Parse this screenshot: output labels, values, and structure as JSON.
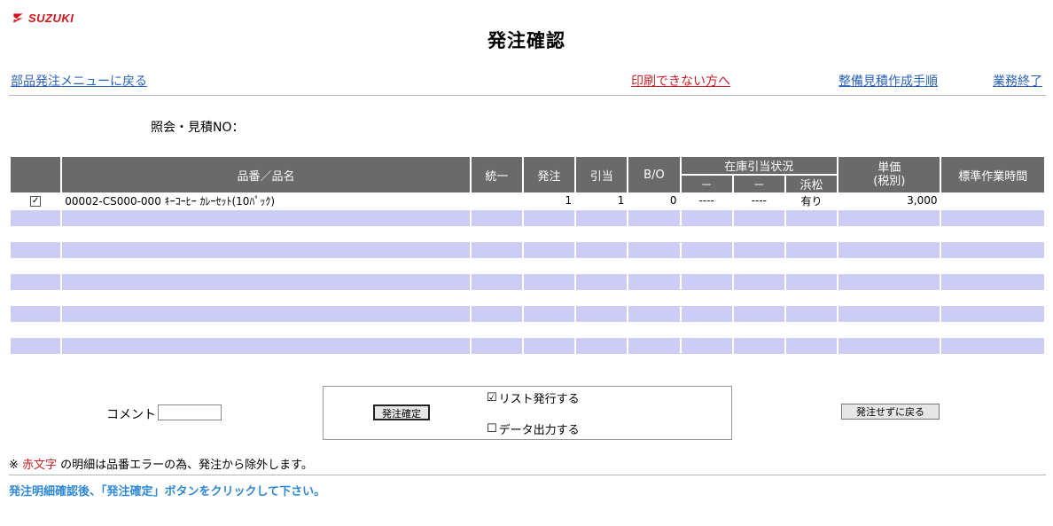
{
  "brand": {
    "logo_text": "SUZUKI",
    "color": "#d0121b"
  },
  "title": "発注確認",
  "nav": {
    "back_menu": "部品発注メニューに戻る",
    "cannot_print": "印刷できない方へ",
    "estimate_procedure": "整備見積作成手順",
    "end_work": "業務終了"
  },
  "ref_label": "照会・見積NO：",
  "table": {
    "headers": {
      "part": "品番／品名",
      "unify": "統一",
      "order": "発注",
      "alloc": "引当",
      "bo": "B/O",
      "stock_status": "在庫引当状況",
      "stock_sub1": "－",
      "stock_sub2": "－",
      "stock_sub3": "浜松",
      "unit_price": "単価",
      "unit_price_sub": "(税別)",
      "std_time": "標準作業時間"
    },
    "rows": [
      {
        "check": "✓",
        "part": "00002-CS000-000 ｷｰｺｰﾋｰ ｶﾚｰｾｯﾄ(10ﾊﾟｯｸ)",
        "unify": "",
        "order": "1",
        "alloc": "1",
        "bo": "0",
        "s1": "----",
        "s2": "----",
        "s3": "有り",
        "price": "3,000",
        "time": ""
      }
    ]
  },
  "comment_label": "コメント",
  "comment_value": "",
  "confirm_button": "発注確定",
  "list_option": "リスト発行する",
  "list_checked": "☑",
  "data_option": "データ出力する",
  "data_checked": "☐",
  "back_button": "発注せずに戻る",
  "note": {
    "prefix": "※ ",
    "red_text": "赤文字",
    "suffix": " の明細は品番エラーの為、発注から除外します。"
  },
  "instruction": "発注明細確認後、「発注確定」ボタンをクリックして下さい。",
  "colors": {
    "header_bg": "#6a6a6a",
    "row_shade": "#ccccf5",
    "link_blue": "#2a63b8",
    "link_red": "#c61e24",
    "instruction": "#2f88d6"
  }
}
